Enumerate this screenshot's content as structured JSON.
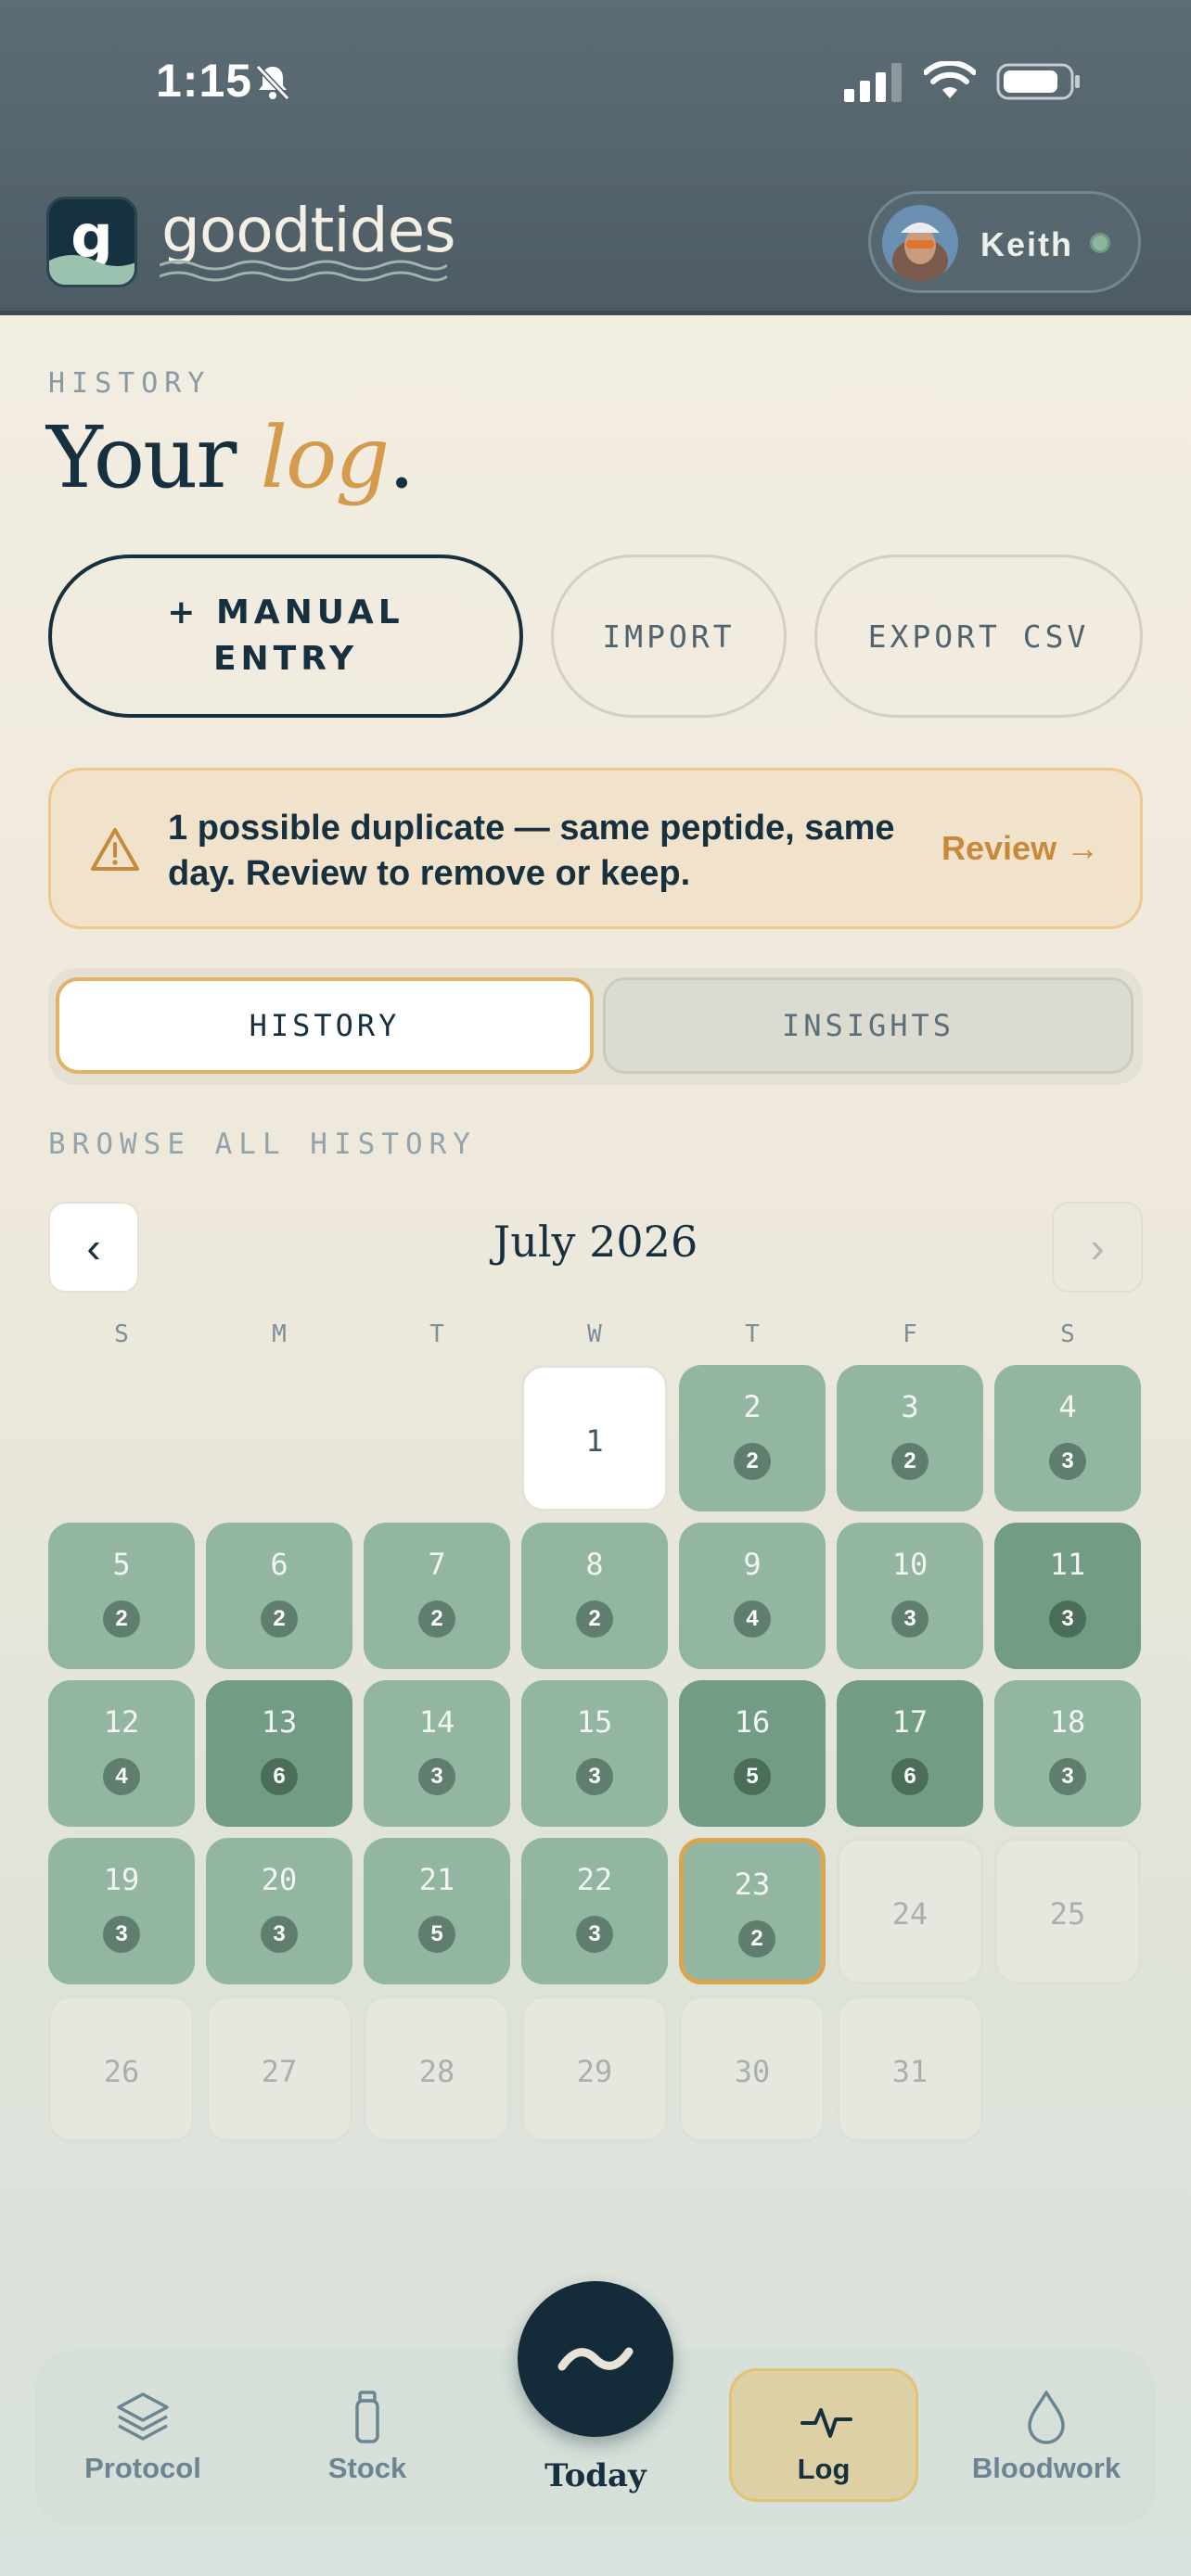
{
  "status_bar": {
    "time": "1:15"
  },
  "brand": {
    "logo_letter": "g",
    "name": "goodtides"
  },
  "user": {
    "name": "Keith"
  },
  "page": {
    "eyebrow": "HISTORY",
    "title_main": "Your ",
    "title_accent": "log",
    "title_end": "."
  },
  "actions": {
    "manual_entry_line1": "+ MANUAL",
    "manual_entry_line2": "ENTRY",
    "import": "IMPORT",
    "export": "EXPORT CSV"
  },
  "alert": {
    "message": "1 possible duplicate — same peptide, same day. Review to remove or keep.",
    "action": "Review →"
  },
  "tabs": {
    "history": "HISTORY",
    "insights": "INSIGHTS"
  },
  "browse_label": "BROWSE ALL HISTORY",
  "calendar": {
    "month": "July 2026",
    "prev": "‹",
    "next": "›",
    "weekdays": [
      "S",
      "M",
      "T",
      "W",
      "T",
      "F",
      "S"
    ],
    "days": [
      {
        "day": "1",
        "count": null,
        "state": "empty"
      },
      {
        "day": "2",
        "count": "2",
        "state": "logged"
      },
      {
        "day": "3",
        "count": "2",
        "state": "logged"
      },
      {
        "day": "4",
        "count": "3",
        "state": "logged"
      },
      {
        "day": "5",
        "count": "2",
        "state": "logged"
      },
      {
        "day": "6",
        "count": "2",
        "state": "logged"
      },
      {
        "day": "7",
        "count": "2",
        "state": "logged"
      },
      {
        "day": "8",
        "count": "2",
        "state": "logged"
      },
      {
        "day": "9",
        "count": "4",
        "state": "logged"
      },
      {
        "day": "10",
        "count": "3",
        "state": "logged"
      },
      {
        "day": "11",
        "count": "3",
        "state": "dark"
      },
      {
        "day": "12",
        "count": "4",
        "state": "logged"
      },
      {
        "day": "13",
        "count": "6",
        "state": "dark"
      },
      {
        "day": "14",
        "count": "3",
        "state": "logged"
      },
      {
        "day": "15",
        "count": "3",
        "state": "logged"
      },
      {
        "day": "16",
        "count": "5",
        "state": "dark"
      },
      {
        "day": "17",
        "count": "6",
        "state": "dark"
      },
      {
        "day": "18",
        "count": "3",
        "state": "logged"
      },
      {
        "day": "19",
        "count": "3",
        "state": "logged"
      },
      {
        "day": "20",
        "count": "3",
        "state": "logged"
      },
      {
        "day": "21",
        "count": "5",
        "state": "logged"
      },
      {
        "day": "22",
        "count": "3",
        "state": "logged"
      },
      {
        "day": "23",
        "count": "2",
        "state": "today"
      },
      {
        "day": "24",
        "count": null,
        "state": "future"
      },
      {
        "day": "25",
        "count": null,
        "state": "future"
      },
      {
        "day": "26",
        "count": null,
        "state": "future"
      },
      {
        "day": "27",
        "count": null,
        "state": "future"
      },
      {
        "day": "28",
        "count": null,
        "state": "future"
      },
      {
        "day": "29",
        "count": null,
        "state": "future"
      },
      {
        "day": "30",
        "count": null,
        "state": "future"
      },
      {
        "day": "31",
        "count": null,
        "state": "future"
      }
    ]
  },
  "bottom_nav": {
    "protocol": "Protocol",
    "stock": "Stock",
    "today": "Today",
    "log": "Log",
    "bloodwork": "Bloodwork"
  },
  "icons": {
    "status": [
      "bell-slash-icon",
      "signal-icon",
      "wifi-icon",
      "battery-icon"
    ],
    "nav": [
      "layers-icon",
      "vial-icon",
      "wave-icon",
      "pulse-icon",
      "drop-icon"
    ],
    "alert": "warning-icon"
  },
  "colors": {
    "accent": "#d49b4c",
    "ink": "#16303f",
    "logged": "#92b6a2",
    "logged_dark": "#729c86",
    "header": "#56656d"
  }
}
